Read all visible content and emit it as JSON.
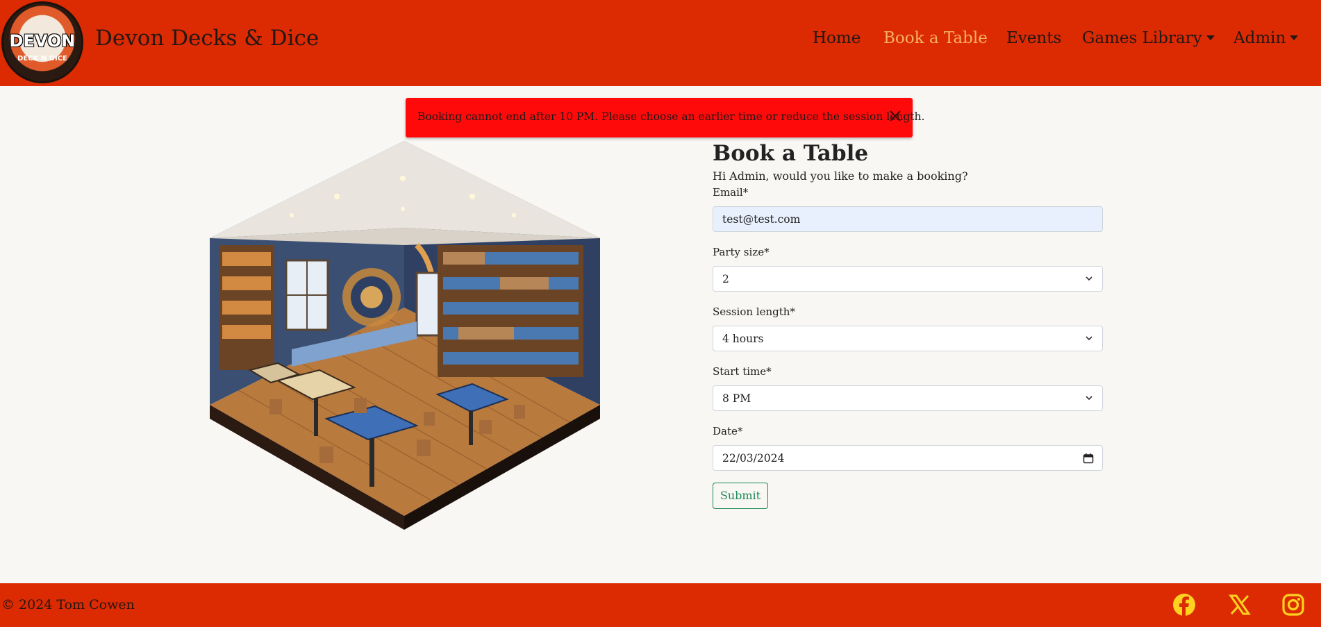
{
  "brand": {
    "name": "Devon Decks & Dice",
    "logo_text": "DEVON",
    "logo_subtext": "DECK N DICE"
  },
  "nav": {
    "items": [
      {
        "label": "Home",
        "active": false,
        "dropdown": false
      },
      {
        "label": "Book a Table",
        "active": true,
        "dropdown": false
      },
      {
        "label": "Events",
        "active": false,
        "dropdown": false
      },
      {
        "label": "Games Library",
        "active": false,
        "dropdown": true
      },
      {
        "label": "Admin",
        "active": false,
        "dropdown": true
      }
    ]
  },
  "alert": {
    "message": "Booking cannot end after 10 PM. Please choose an earlier time or reduce the session length.",
    "close_icon": "close-icon"
  },
  "hero_image": {
    "icon": "isometric-game-room-illustration"
  },
  "form": {
    "title": "Book a Table",
    "greeting": "Hi Admin, would you like to make a booking?",
    "email": {
      "label": "Email*",
      "value": "test@test.com"
    },
    "party_size": {
      "label": "Party size*",
      "value": "2"
    },
    "session_length": {
      "label": "Session length*",
      "value": "4 hours"
    },
    "start_time": {
      "label": "Start time*",
      "value": "8 PM"
    },
    "date": {
      "label": "Date*",
      "value": "22/03/2024"
    },
    "submit_label": "Submit"
  },
  "footer": {
    "copyright": "© 2024 Tom Cowen",
    "social": [
      "facebook-icon",
      "x-icon",
      "instagram-icon"
    ]
  },
  "colors": {
    "primary": "#dc2a02",
    "active_nav": "#f6b066",
    "alert_bg": "#ff0a0a",
    "submit": "#198754",
    "social_icons": "#ffd21f",
    "page_bg": "#f9f7f4"
  }
}
